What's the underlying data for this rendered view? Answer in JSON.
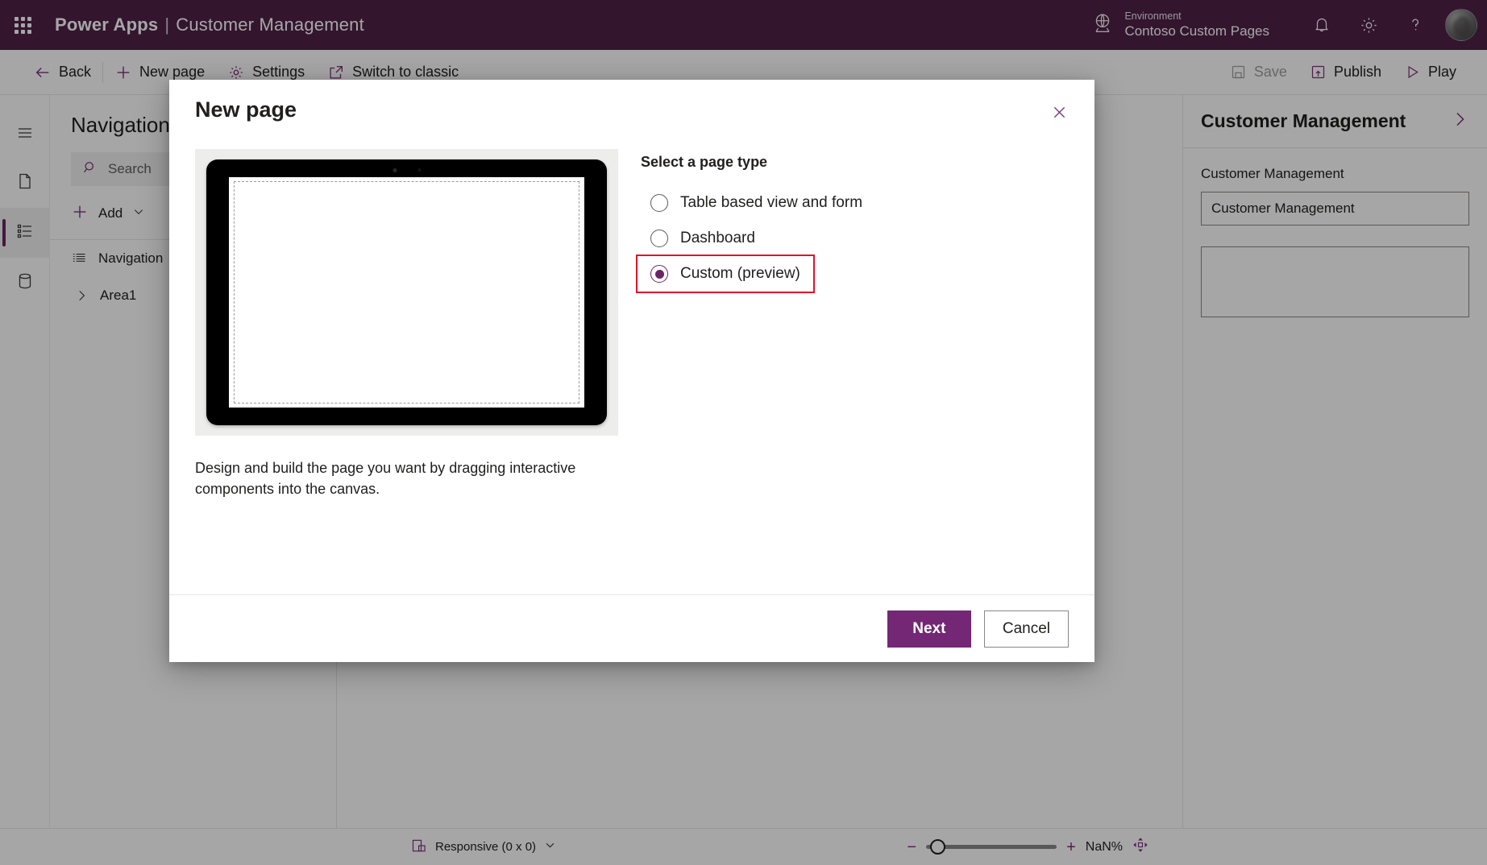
{
  "brand": {
    "waffle_icon": "app-launcher-icon",
    "product": "Power Apps",
    "separator": "|",
    "app_name": "Customer Management",
    "environment_label": "Environment",
    "environment_value": "Contoso Custom Pages",
    "globe_icon": "globe-icon",
    "notifications_icon": "bell-icon",
    "settings_icon": "gear-icon",
    "help_icon": "question-mark-icon",
    "avatar_icon": "user-avatar"
  },
  "commandbar": {
    "back": "Back",
    "new_page": "New page",
    "settings": "Settings",
    "switch_to_classic": "Switch to classic",
    "save": "Save",
    "publish": "Publish",
    "play": "Play"
  },
  "rail": {
    "items": [
      {
        "name": "hamburger-menu",
        "icon": "hamburger-icon"
      },
      {
        "name": "pages",
        "icon": "page-icon"
      },
      {
        "name": "navigation",
        "icon": "navigation-list-icon"
      },
      {
        "name": "data",
        "icon": "database-icon"
      }
    ]
  },
  "navpanel": {
    "title": "Navigation",
    "search_placeholder": "Search",
    "search_icon": "search-icon",
    "add_label": "Add",
    "add_icon": "plus-icon",
    "add_chevron": "chevron-down-icon",
    "tree": [
      {
        "label": "Navigation",
        "icon": "list-icon",
        "expandable": false
      },
      {
        "label": "Area1",
        "icon": "chevron-right-icon",
        "expandable": true
      }
    ]
  },
  "properties": {
    "header_title": "Customer Management",
    "header_chevron": "chevron-right-icon",
    "field_label": "Customer Management",
    "input_value": "Customer Management",
    "textarea_value": ""
  },
  "statusbar": {
    "screen_icon": "responsive-screen-icon",
    "screen_size_label": "Responsive (0 x 0)",
    "screen_size_chevron": "chevron-down-icon",
    "zoom_out_icon": "minus-icon",
    "zoom_in_icon": "plus-icon",
    "zoom_value": "NaN%",
    "fit_icon": "fit-to-screen-icon"
  },
  "dialog": {
    "title": "New page",
    "close_icon": "close-icon",
    "preview": {
      "device_icon": "tablet-device-illustration",
      "description": "Design and build the page you want by dragging interactive components into the canvas."
    },
    "select_label": "Select a page type",
    "options": [
      {
        "label": "Table based view and form",
        "selected": false,
        "highlighted": false
      },
      {
        "label": "Dashboard",
        "selected": false,
        "highlighted": false
      },
      {
        "label": "Custom (preview)",
        "selected": true,
        "highlighted": true
      }
    ],
    "primary_button": "Next",
    "secondary_button": "Cancel",
    "highlight_color": "#e3122a"
  },
  "colors": {
    "brand_purple": "#4f2148",
    "accent_purple": "#7a2f78",
    "button_purple": "#742774",
    "highlight_red": "#e3122a"
  }
}
